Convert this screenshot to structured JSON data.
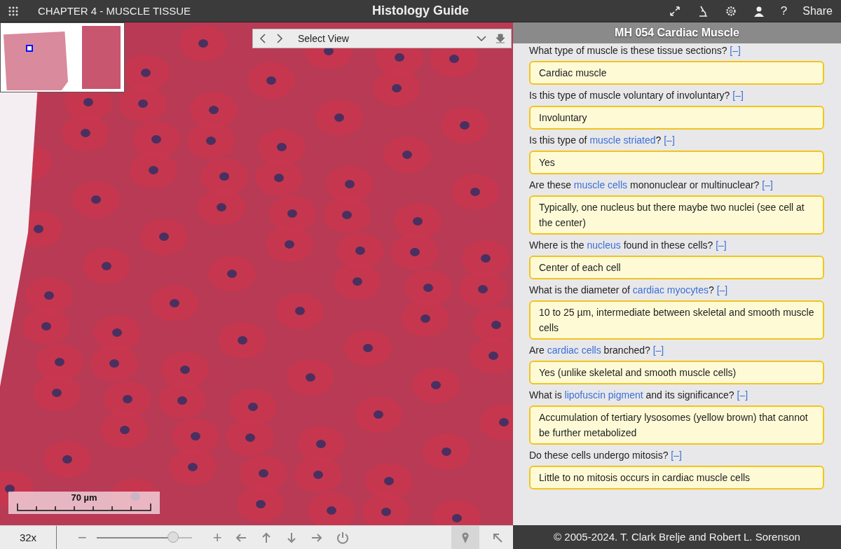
{
  "topbar": {
    "chapter": "CHAPTER 4 - MUSCLE TISSUE",
    "title": "Histology Guide",
    "share": "Share",
    "help": "?"
  },
  "viewer": {
    "select_view": "Select View",
    "scale_label": "70 µm",
    "zoom_level": "32x",
    "zoom_out": "−",
    "zoom_in": "+",
    "zoom_slider": {
      "level": 0.8
    },
    "pin_active": true
  },
  "panel": {
    "title": "MH 054 Cardiac Muscle",
    "items": [
      {
        "question": [
          {
            "text": "What type of muscle is these tissue sections?",
            "link": false
          }
        ],
        "toggle": "[–]",
        "answer": "Cardiac muscle"
      },
      {
        "question": [
          {
            "text": "Is this type of muscle voluntary of involuntary?",
            "link": false
          }
        ],
        "toggle": "[–]",
        "answer": "Involuntary"
      },
      {
        "question": [
          {
            "text": "Is this type of",
            "link": false
          },
          {
            "text": "muscle striated",
            "link": true
          },
          {
            "text": "?",
            "link": false
          }
        ],
        "toggle": "[–]",
        "answer": "Yes"
      },
      {
        "question": [
          {
            "text": "Are these",
            "link": false
          },
          {
            "text": "muscle cells",
            "link": true
          },
          {
            "text": "mononuclear or multinuclear?",
            "link": false
          }
        ],
        "toggle": "[–]",
        "answer": "Typically, one nucleus but there maybe two nuclei (see cell at the center)"
      },
      {
        "question": [
          {
            "text": "Where is the",
            "link": false
          },
          {
            "text": "nucleus",
            "link": true
          },
          {
            "text": "found in these cells?",
            "link": false
          }
        ],
        "toggle": "[–]",
        "answer": "Center of each cell"
      },
      {
        "question": [
          {
            "text": "What is the diameter of",
            "link": false
          },
          {
            "text": "cardiac myocytes",
            "link": true
          },
          {
            "text": "?",
            "link": false
          }
        ],
        "toggle": "[–]",
        "answer": "10 to 25 µm, intermediate between skeletal and smooth muscle cells"
      },
      {
        "question": [
          {
            "text": "Are",
            "link": false
          },
          {
            "text": "cardiac cells",
            "link": true
          },
          {
            "text": "branched?",
            "link": false
          }
        ],
        "toggle": "[–]",
        "answer": "Yes (unlike skeletal and smooth muscle cells)"
      },
      {
        "question": [
          {
            "text": "What is",
            "link": false
          },
          {
            "text": "lipofuscin pigment",
            "link": true
          },
          {
            "text": "and its significance?",
            "link": false
          }
        ],
        "toggle": "[–]",
        "answer": "Accumulation of tertiary lysosomes (yellow brown) that cannot be further metabolized"
      },
      {
        "question": [
          {
            "text": "Do these cells undergo mitosis?",
            "link": false
          }
        ],
        "toggle": "[–]",
        "answer": "Little to no mitosis occurs in cardiac muscle cells"
      }
    ],
    "footer": "© 2005-2024. T. Clark Brelje and Robert L. Sorenson"
  }
}
